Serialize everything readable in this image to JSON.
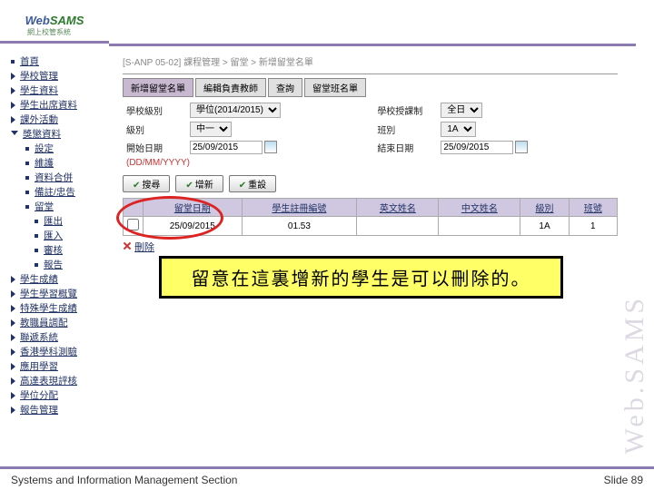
{
  "logo": {
    "part1": "Web",
    "part2": "SAMS",
    "subtitle": "網上校管系統"
  },
  "breadcrumb": "[S-ANP 05-02] 課程管理 > 留堂 > 新增留堂名單",
  "sidebar": {
    "items": [
      {
        "label": "首頁",
        "type": "dot",
        "indent": 0
      },
      {
        "label": "學校管理",
        "type": "tri",
        "indent": 0
      },
      {
        "label": "學生資料",
        "type": "tri",
        "indent": 0
      },
      {
        "label": "學生出席資料",
        "type": "tri",
        "indent": 0
      },
      {
        "label": "課外活動",
        "type": "tri",
        "indent": 0
      },
      {
        "label": "獎懲資料",
        "type": "down",
        "indent": 0
      },
      {
        "label": "設定",
        "type": "dot",
        "indent": 1
      },
      {
        "label": "維護",
        "type": "dot",
        "indent": 1
      },
      {
        "label": "資料合併",
        "type": "dot",
        "indent": 1
      },
      {
        "label": "備註/忠告",
        "type": "dot",
        "indent": 1
      },
      {
        "label": "留堂",
        "type": "dot",
        "indent": 1
      },
      {
        "label": "匯出",
        "type": "dot",
        "indent": 2
      },
      {
        "label": "匯入",
        "type": "dot",
        "indent": 2
      },
      {
        "label": "審核",
        "type": "dot",
        "indent": 2
      },
      {
        "label": "報告",
        "type": "dot",
        "indent": 2
      },
      {
        "label": "學生成績",
        "type": "tri",
        "indent": 0
      },
      {
        "label": "學生學習概覽",
        "type": "tri",
        "indent": 0
      },
      {
        "label": "特殊學生成績",
        "type": "tri",
        "indent": 0
      },
      {
        "label": "教職員調配",
        "type": "tri",
        "indent": 0
      },
      {
        "label": "聯遞系統",
        "type": "tri",
        "indent": 0
      },
      {
        "label": "香港學科測驗",
        "type": "tri",
        "indent": 0
      },
      {
        "label": "應用學習",
        "type": "tri",
        "indent": 0
      },
      {
        "label": "高達表現評核",
        "type": "tri",
        "indent": 0
      },
      {
        "label": "學位分配",
        "type": "tri",
        "indent": 0
      },
      {
        "label": "報告管理",
        "type": "tri",
        "indent": 0
      }
    ]
  },
  "tabs": [
    {
      "label": "新增留堂名單",
      "active": true
    },
    {
      "label": "編輯負責教師",
      "active": false
    },
    {
      "label": "查詢",
      "active": false
    },
    {
      "label": "留堂班名單",
      "active": false
    }
  ],
  "form": {
    "level_label": "學校級別",
    "level_value": "學位(2014/2015)",
    "session_label": "學校授課制",
    "session_value": "全日",
    "class_label": "級別",
    "class_value": "中一",
    "classno_label": "班別",
    "classno_value": "1A",
    "start_label": "開始日期",
    "start_value": "25/09/2015",
    "end_label": "結束日期",
    "end_value": "25/09/2015",
    "date_hint": "(DD/MM/YYYY)"
  },
  "buttons": {
    "search": "搜尋",
    "add": "增新",
    "reset": "重設",
    "delete": "刪除"
  },
  "table": {
    "headers": [
      "",
      "留堂日期",
      "學生註冊編號",
      "英文姓名",
      "中文姓名",
      "級別",
      "班號"
    ],
    "rows": [
      {
        "date": "25/09/2015",
        "regno": "01.53",
        "ename": "",
        "cname": "",
        "class": "1A",
        "no": "1"
      }
    ]
  },
  "callout": "留意在這裏增新的學生是可以刪除的。",
  "watermark": "Web.SAMS",
  "footer": {
    "left": "Systems and Information Management Section",
    "right": "Slide 89"
  }
}
